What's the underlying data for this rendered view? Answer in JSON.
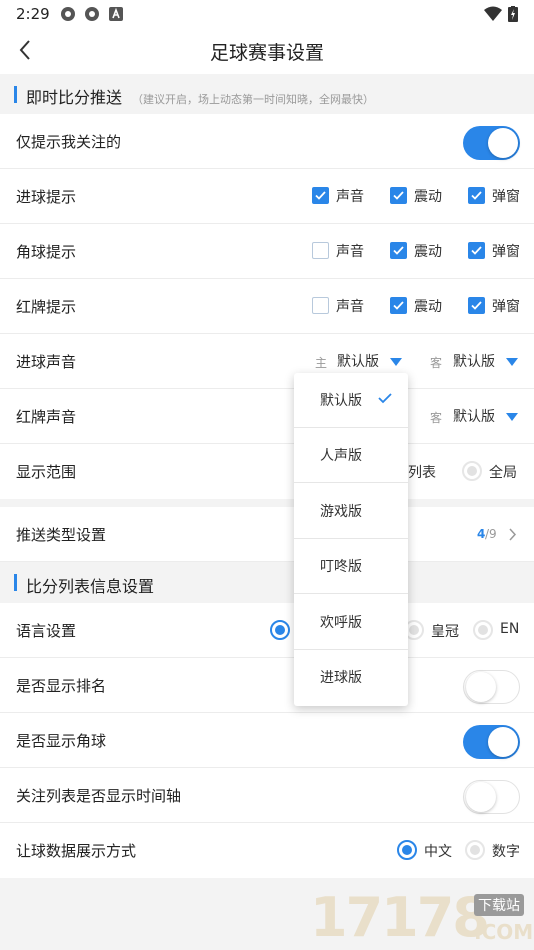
{
  "status_bar": {
    "time": "2:29"
  },
  "app_bar": {
    "title": "足球赛事设置"
  },
  "section_live": {
    "title": "即时比分推送",
    "hint": "（建议开启，场上动态第一时间知晓，全网最快）"
  },
  "rows": {
    "follow_only": {
      "label": "仅提示我关注的",
      "enabled": true
    },
    "goal_alert": {
      "label": "进球提示",
      "options": [
        {
          "label": "声音",
          "checked": true
        },
        {
          "label": "震动",
          "checked": true
        },
        {
          "label": "弹窗",
          "checked": true
        }
      ]
    },
    "corner_alert": {
      "label": "角球提示",
      "options": [
        {
          "label": "声音",
          "checked": false
        },
        {
          "label": "震动",
          "checked": true
        },
        {
          "label": "弹窗",
          "checked": true
        }
      ]
    },
    "red_alert": {
      "label": "红牌提示",
      "options": [
        {
          "label": "声音",
          "checked": false
        },
        {
          "label": "震动",
          "checked": true
        },
        {
          "label": "弹窗",
          "checked": true
        }
      ]
    },
    "goal_sound": {
      "label": "进球声音",
      "home_prefix": "主",
      "home_value": "默认版",
      "away_prefix": "客",
      "away_value": "默认版"
    },
    "red_sound": {
      "label": "红牌声音",
      "away_prefix": "客",
      "away_value": "默认版"
    },
    "display_range": {
      "label": "显示范围",
      "option_partial": "列表",
      "option_all": "全局"
    },
    "push_type": {
      "label": "推送类型设置",
      "count_selected": "4",
      "count_total": "/9"
    }
  },
  "section_list": {
    "title": "比分列表信息设置"
  },
  "list_rows": {
    "language": {
      "label": "语言设置",
      "option_crown": "皇冠",
      "option_en": "EN"
    },
    "show_rank": {
      "label": "是否显示排名",
      "enabled": false
    },
    "show_corner": {
      "label": "是否显示角球",
      "enabled": true
    },
    "timeline": {
      "label": "关注列表是否显示时间轴",
      "enabled": false
    },
    "handicap": {
      "label": "让球数据展示方式",
      "option_cn": "中文",
      "option_num": "数字"
    }
  },
  "dropdown": {
    "items": [
      "默认版",
      "人声版",
      "游戏版",
      "叮咚版",
      "欢呼版",
      "进球版"
    ],
    "selected_index": 0
  },
  "watermark": {
    "text_main": "17178",
    "text_badge": "下载站",
    "text_domain": ".COM"
  },
  "colors": {
    "accent": "#2a86e8",
    "background": "#f3f3f3"
  }
}
